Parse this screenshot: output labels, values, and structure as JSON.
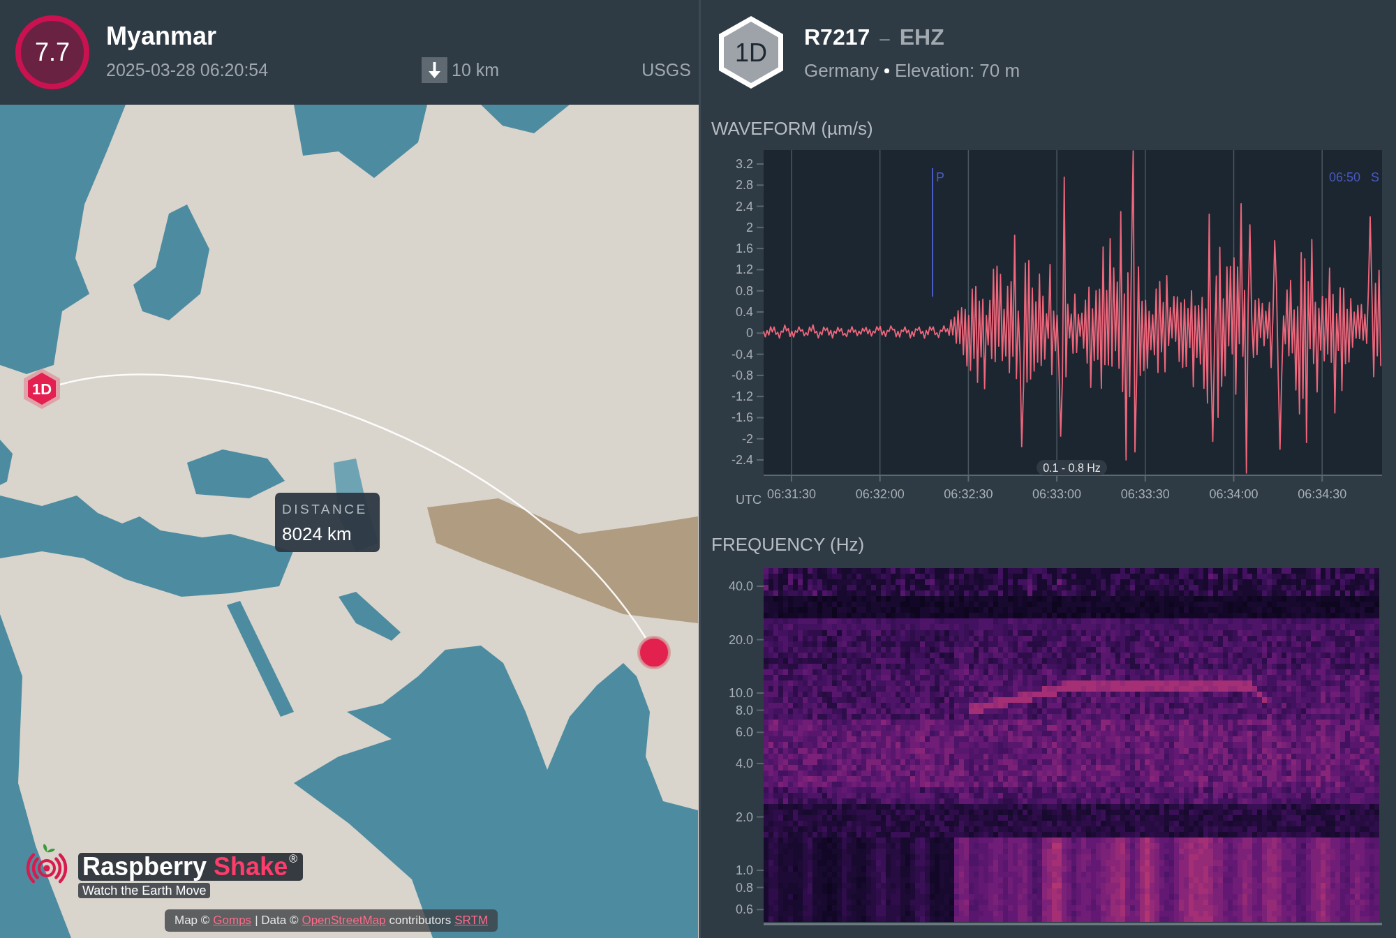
{
  "event": {
    "magnitude": "7.7",
    "region": "Myanmar",
    "time": "2025-03-28 06:20:54",
    "depth": "10 km",
    "source": "USGS"
  },
  "map": {
    "station_marker": "1D",
    "distance": {
      "label": "DISTANCE",
      "value": "8024 km"
    },
    "logo": {
      "name": "Raspberry",
      "accent": "Shake",
      "mark": "®",
      "tagline": "Watch the Earth Move"
    },
    "attribution": [
      {
        "kind": "text",
        "text": "Map ©"
      },
      {
        "kind": "link",
        "text": "Gomps"
      },
      {
        "kind": "text",
        "text": "| Data ©"
      },
      {
        "kind": "link",
        "text": "OpenStreetMap"
      },
      {
        "kind": "text",
        "text": "contributors"
      },
      {
        "kind": "link",
        "text": "SRTM"
      }
    ]
  },
  "station": {
    "badge": "1D",
    "code": "R7217",
    "separator": "–",
    "channel": "EHZ",
    "country": "Germany",
    "elevation": "Elevation: 70 m"
  },
  "waveform": {
    "title": "WAVEFORM (µm/s)",
    "y_ticks": [
      "3.2",
      "2.8",
      "2.4",
      "2",
      "1.6",
      "1.2",
      "0.8",
      "0.4",
      "0",
      "-0.4",
      "-0.8",
      "-1.2",
      "-1.6",
      "-2",
      "-2.4"
    ],
    "x_ticks": [
      "06:31:30",
      "06:32:00",
      "06:32:30",
      "06:33:00",
      "06:33:30",
      "06:34:00",
      "06:34:30"
    ],
    "x_label": "UTC",
    "p_marker": "P",
    "s_time": "06:50",
    "s_marker": "S",
    "filter": "0.1 - 0.8 Hz"
  },
  "spectrogram": {
    "title": "FREQUENCY (Hz)",
    "y_ticks": [
      "40.0",
      "20.0",
      "10.0",
      "8.0",
      "6.0",
      "4.0",
      "2.0",
      "1.0",
      "0.8",
      "0.6"
    ]
  }
}
